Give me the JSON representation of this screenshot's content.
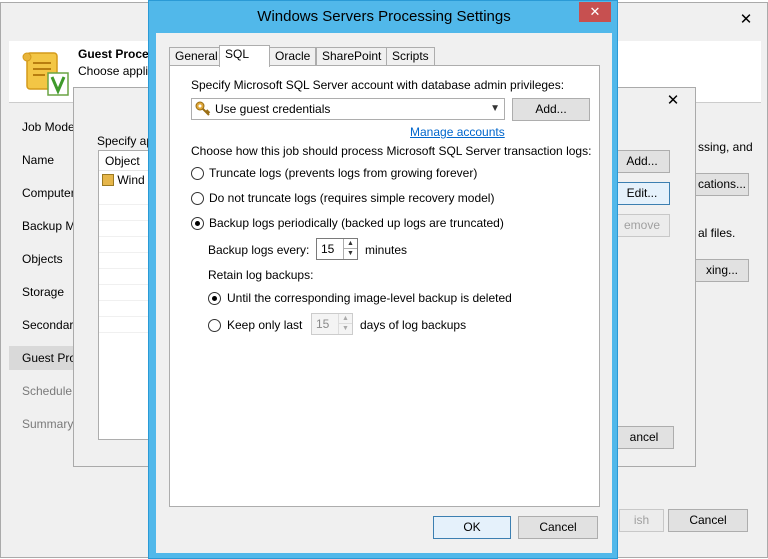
{
  "back_window": {
    "header_title": "Guest Proces",
    "header_subtitle": "Choose appli",
    "steps": [
      "Job Mode",
      "Name",
      "Computer",
      "Backup M",
      "Objects",
      "Storage",
      "Secondary",
      "Guest Pro",
      "Schedule",
      "Summary"
    ],
    "right_text": {
      "line1": "ssing, and",
      "line2": "al files."
    },
    "buttons": {
      "applications": "cations...",
      "indexing": "xing...",
      "finish": "ish",
      "cancel": "Cancel"
    }
  },
  "mid_window": {
    "specify_label": "Specify ap",
    "list_header": "Object",
    "list_row": "Wind",
    "buttons": {
      "add": "Add...",
      "edit": "Edit...",
      "remove": "emove",
      "cancel": "ancel"
    }
  },
  "dialog": {
    "title": "Windows Servers Processing Settings",
    "tabs": [
      "General",
      "SQL",
      "Oracle",
      "SharePoint",
      "Scripts"
    ],
    "active_tab": "SQL",
    "account_label": "Specify Microsoft SQL Server account with database admin privileges:",
    "account_value": "Use guest credentials",
    "add_button": "Add...",
    "manage_link": "Manage accounts",
    "log_choice_label": "Choose how this job should process Microsoft SQL Server transaction logs:",
    "log_options": [
      {
        "label": "Truncate logs (prevents logs from growing forever)",
        "checked": false
      },
      {
        "label": "Do not truncate logs (requires simple recovery model)",
        "checked": false
      },
      {
        "label": "Backup logs periodically (backed up logs are truncated)",
        "checked": true
      }
    ],
    "backup_every_label": "Backup logs every:",
    "backup_every_value": "15",
    "backup_every_unit": "minutes",
    "retain_label": "Retain log backups:",
    "retain_options": [
      {
        "label": "Until the corresponding image-level backup is deleted",
        "checked": true
      },
      {
        "label": "Keep only last",
        "checked": false
      }
    ],
    "keep_value": "15",
    "keep_unit": "days of log backups",
    "ok_button": "OK",
    "cancel_button": "Cancel"
  },
  "colors": {
    "dialog_border": "#51b8ea",
    "close_button": "#c75050",
    "link": "#0066cc"
  }
}
